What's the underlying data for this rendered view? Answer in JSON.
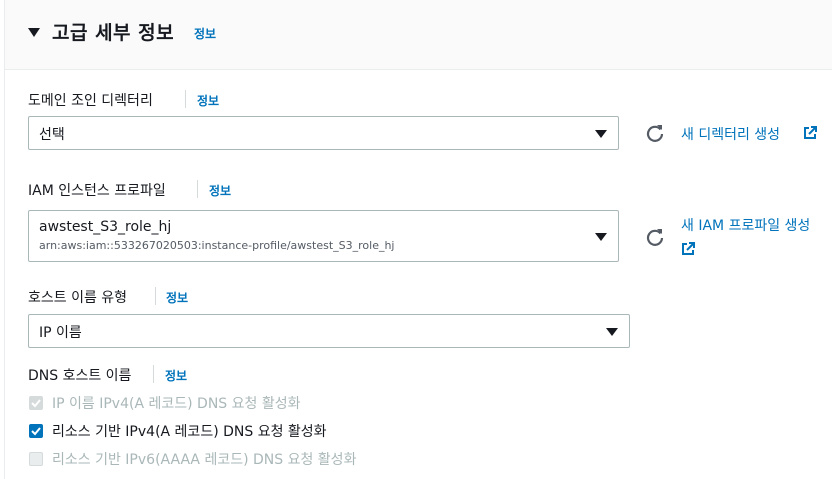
{
  "section": {
    "title": "고급 세부 정보",
    "info": "정보"
  },
  "domain_join": {
    "label": "도메인 조인 디렉터리",
    "info": "정보",
    "selected": "선택",
    "new_link": "새 디렉터리 생성"
  },
  "iam_profile": {
    "label": "IAM 인스턴스 프로파일",
    "info": "정보",
    "selected": "awstest_S3_role_hj",
    "arn": "arn:aws:iam::533267020503:instance-profile/awstest_S3_role_hj",
    "new_link": "새 IAM 프로파일 생성"
  },
  "hostname_type": {
    "label": "호스트 이름 유형",
    "info": "정보",
    "selected": "IP 이름"
  },
  "dns_hostname": {
    "label": "DNS 호스트 이름",
    "info": "정보",
    "options": [
      {
        "label": "IP 이름 IPv4(A 레코드) DNS 요청 활성화",
        "checked": true,
        "disabled": true
      },
      {
        "label": "리소스 기반 IPv4(A 레코드) DNS 요청 활성화",
        "checked": true,
        "disabled": false
      },
      {
        "label": "리소스 기반 IPv6(AAAA 레코드) DNS 요청 활성화",
        "checked": false,
        "disabled": true
      }
    ]
  },
  "colors": {
    "link": "#0073bb",
    "checkbox": "#0073bb",
    "disabled": "#aab7b8"
  }
}
